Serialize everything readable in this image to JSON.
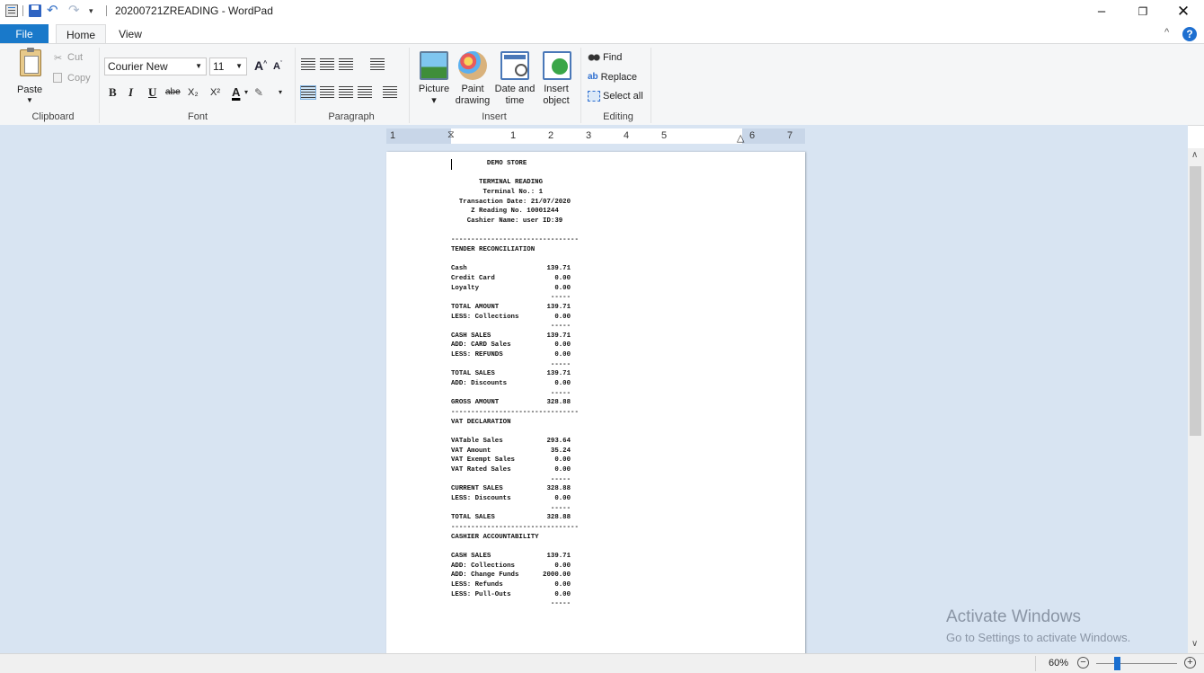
{
  "window": {
    "title": "20200721ZREADING - WordPad",
    "minimize": "–",
    "maximize": "❐",
    "close": "✕"
  },
  "tabs": {
    "file": "File",
    "home": "Home",
    "view": "View"
  },
  "ribbon": {
    "clipboard": {
      "group": "Clipboard",
      "paste": "Paste",
      "cut": "Cut",
      "copy": "Copy"
    },
    "font": {
      "group": "Font",
      "family": "Courier New",
      "size": "11",
      "bold": "B",
      "italic": "I",
      "underline": "U",
      "strike": "abe",
      "subscript": "X₂",
      "superscript": "X²",
      "color": "A"
    },
    "paragraph": {
      "group": "Paragraph"
    },
    "insert": {
      "group": "Insert",
      "picture": "Picture",
      "paint_line1": "Paint",
      "paint_line2": "drawing",
      "date_line1": "Date and",
      "date_line2": "time",
      "object_line1": "Insert",
      "object_line2": "object"
    },
    "editing": {
      "group": "Editing",
      "find": "Find",
      "replace": "Replace",
      "select_all": "Select all"
    }
  },
  "ruler": {
    "numbers": [
      "1",
      "1",
      "2",
      "3",
      "4",
      "5",
      "6",
      "7"
    ]
  },
  "document": {
    "text": "         DEMO STORE\n\n       TERMINAL READING\n        Terminal No.: 1\n  Transaction Date: 21/07/2020\n     Z Reading No. 10001244\n    Cashier Name: user ID:39\n\n--------------------------------\nTENDER RECONCILIATION\n\nCash                    139.71\nCredit Card               0.00\nLoyalty                   0.00\n                         -----\nTOTAL AMOUNT            139.71\nLESS: Collections         0.00\n                         -----\nCASH SALES              139.71\nADD: CARD Sales           0.00\nLESS: REFUNDS             0.00\n                         -----\nTOTAL SALES             139.71\nADD: Discounts            0.00\n                         -----\nGROSS AMOUNT            328.88\n--------------------------------\nVAT DECLARATION\n\nVATable Sales           293.64\nVAT Amount               35.24\nVAT Exempt Sales          0.00\nVAT Rated Sales           0.00\n                         -----\nCURRENT SALES           328.88\nLESS: Discounts           0.00\n                         -----\nTOTAL SALES             328.88\n--------------------------------\nCASHIER ACCOUNTABILITY\n\nCASH SALES              139.71\nADD: Collections          0.00\nADD: Change Funds      2000.00\nLESS: Refunds             0.00\nLESS: Pull-Outs           0.00\n                         -----"
  },
  "watermark": {
    "line1": "Activate Windows",
    "line2": "Go to Settings to activate Windows."
  },
  "status": {
    "zoom": "60%",
    "zoom_fraction": 0.25
  },
  "colors": {
    "accent": "#1979ca",
    "workspace": "#d8e4f2"
  }
}
